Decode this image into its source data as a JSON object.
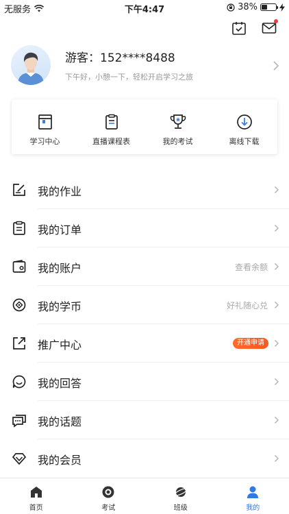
{
  "status_bar": {
    "carrier": "无服务",
    "time": "下午4:47",
    "battery": "38%",
    "battery_level": 0.38
  },
  "profile": {
    "name": "游客：152****8488",
    "greeting": "下午好，小憩一下，轻松开启学习之旅"
  },
  "quick_actions": [
    {
      "label": "学习中心",
      "icon": "book-icon"
    },
    {
      "label": "直播课程表",
      "icon": "clipboard-icon"
    },
    {
      "label": "我的考试",
      "icon": "trophy-icon"
    },
    {
      "label": "离线下载",
      "icon": "download-icon"
    }
  ],
  "menu": [
    {
      "label": "我的作业",
      "icon": "edit-icon",
      "right": ""
    },
    {
      "label": "我的订单",
      "icon": "order-icon",
      "right": ""
    },
    {
      "label": "我的账户",
      "icon": "wallet-icon",
      "right": "查看余额"
    },
    {
      "label": "我的学币",
      "icon": "coin-icon",
      "right": "好礼随心兑"
    },
    {
      "label": "推广中心",
      "icon": "share-icon",
      "badge": "开通申请"
    },
    {
      "label": "我的回答",
      "icon": "chat-icon",
      "right": ""
    },
    {
      "label": "我的话题",
      "icon": "topic-icon",
      "right": ""
    },
    {
      "label": "我的会员",
      "icon": "diamond-icon",
      "right": ""
    }
  ],
  "tabbar": [
    {
      "label": "首页",
      "icon": "home-icon"
    },
    {
      "label": "考试",
      "icon": "exam-icon"
    },
    {
      "label": "班级",
      "icon": "planet-icon"
    },
    {
      "label": "我的",
      "icon": "person-icon",
      "active": true
    }
  ],
  "colors": {
    "accent": "#2f7be6",
    "badge": "#f45b1f",
    "notification_dot": "#f03c3c"
  }
}
